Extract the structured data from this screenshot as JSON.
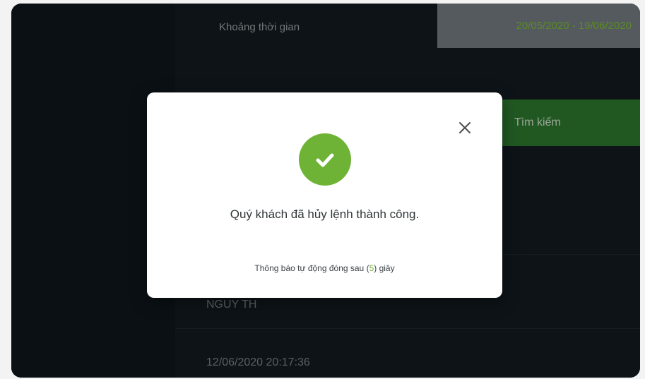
{
  "filter": {
    "range_label": "Khoảng thời gian",
    "date_range": "20/05/2020 - 19/06/2020",
    "search_label": "Tìm kiếm"
  },
  "table": {
    "rows": [
      {
        "text": "NGUY TH"
      },
      {
        "text": "12/06/2020 20:17:36"
      }
    ]
  },
  "modal": {
    "message": "Quý khách đã hủy lệnh thành công.",
    "auto_close_prefix": "Thông báo tự động đóng sau (",
    "auto_close_count": "5",
    "auto_close_suffix": ") giây"
  },
  "colors": {
    "accent": "#6eb335",
    "search_button": "#2e7a30",
    "background": "#0c1216"
  },
  "icons": {
    "success": "check-circle-icon",
    "close": "close-icon"
  }
}
